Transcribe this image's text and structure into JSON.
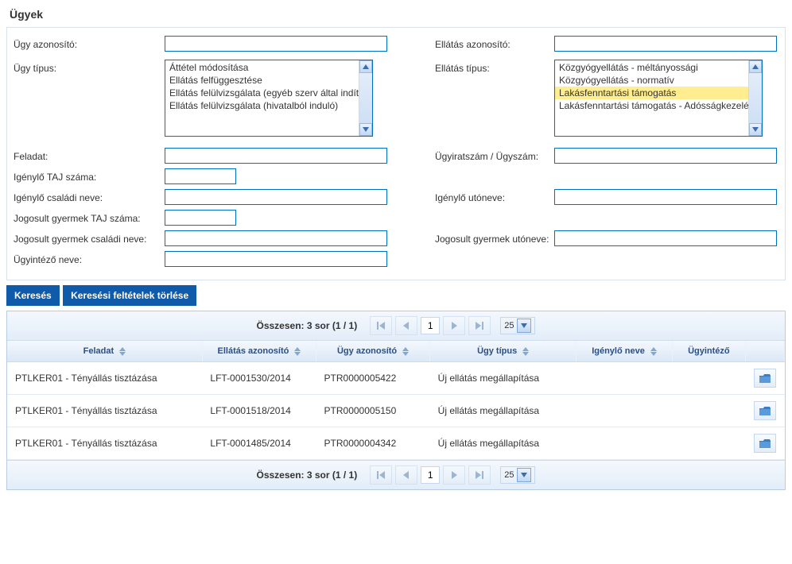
{
  "page_title": "Ügyek",
  "filters": {
    "ugy_azonosito_label": "Ügy azonosító:",
    "ellatas_azonosito_label": "Ellátás azonosító:",
    "ugy_tipus_label": "Ügy típus:",
    "ellatas_tipus_label": "Ellátás típus:",
    "feladat_label": "Feladat:",
    "ugyiratszam_label": "Ügyiratszám / Ügyszám:",
    "igenylo_taj_label": "Igénylő TAJ száma:",
    "igenylo_csaladi_label": "Igénylő családi neve:",
    "igenylo_uto_label": "Igénylő utóneve:",
    "jogosult_taj_label": "Jogosult gyermek TAJ száma:",
    "jogosult_csaladi_label": "Jogosult gyermek családi neve:",
    "jogosult_uto_label": "Jogosult gyermek utóneve:",
    "ugyintezo_label": "Ügyintéző neve:"
  },
  "ugy_tipus_options": [
    "Áttétel módosítása",
    "Ellátás felfüggesztése",
    "Ellátás felülvizsgálata (egyéb szerv által indított)",
    "Ellátás felülvizsgálata (hivatalból induló)"
  ],
  "ellatas_tipus_options": [
    "Közgyógyellátás - méltányossági",
    "Közgyógyellátás - normatív",
    "Lakásfenntartási támogatás",
    "Lakásfenntartási támogatás - Adósságkezelési támogatás"
  ],
  "ellatas_tipus_selected_index": 2,
  "buttons": {
    "search": "Keresés",
    "clear": "Keresési feltételek törlése"
  },
  "pager": {
    "summary": "Összesen: 3 sor (1 / 1)",
    "page": "1",
    "page_size": "25"
  },
  "table": {
    "headers": {
      "feladat": "Feladat",
      "ellatas_azonosito": "Ellátás azonosító",
      "ugy_azonosito": "Ügy azonosító",
      "ugy_tipus": "Ügy típus",
      "igenylo_neve": "Igénylő neve",
      "ugyintezo": "Ügyintéző"
    },
    "rows": [
      {
        "feladat": "PTLKER01 - Tényállás tisztázása",
        "ellatas_azonosito": "LFT-0001530/2014",
        "ugy_azonosito": "PTR0000005422",
        "ugy_tipus": "Új ellátás megállapítása",
        "igenylo_neve": "",
        "ugyintezo": ""
      },
      {
        "feladat": "PTLKER01 - Tényállás tisztázása",
        "ellatas_azonosito": "LFT-0001518/2014",
        "ugy_azonosito": "PTR0000005150",
        "ugy_tipus": "Új ellátás megállapítása",
        "igenylo_neve": "",
        "ugyintezo": ""
      },
      {
        "feladat": "PTLKER01 - Tényállás tisztázása",
        "ellatas_azonosito": "LFT-0001485/2014",
        "ugy_azonosito": "PTR0000004342",
        "ugy_tipus": "Új ellátás megállapítása",
        "igenylo_neve": "",
        "ugyintezo": ""
      }
    ]
  }
}
